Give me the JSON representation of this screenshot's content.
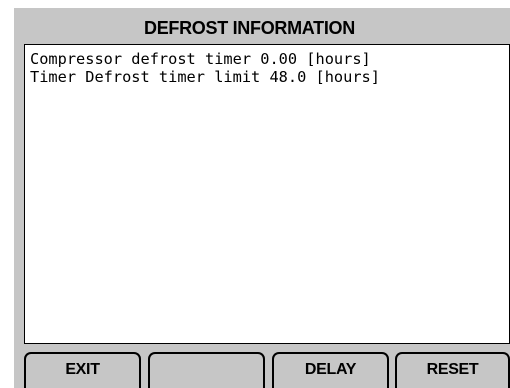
{
  "title": "DEFROST INFORMATION",
  "content": {
    "lines": [
      "Compressor defrost timer 0.00 [hours]",
      "Timer Defrost timer limit 48.0 [hours]"
    ]
  },
  "softkeys": {
    "exit": "EXIT",
    "blank": "",
    "delay": "DELAY",
    "reset": "RESET"
  },
  "colors": {
    "panel": "#c6c6c6",
    "content_bg": "#ffffff",
    "text": "#000000"
  }
}
